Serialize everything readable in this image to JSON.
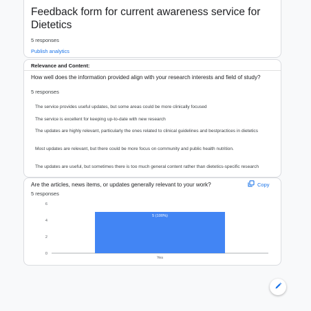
{
  "header": {
    "title": "Feedback form for current awareness service for Dietetics",
    "response_count": "5 responses",
    "publish_link": "Publish analytics"
  },
  "section": {
    "label": "Relevance and Content:"
  },
  "question1": {
    "title": "How well does the information provided align with your research interests and field of study?",
    "response_count": "5 responses",
    "answers": [
      "The service provides useful updates, but some areas could be more clinically focused",
      "The service is excellent for keeping up-to-date with new research",
      "The updates are highly relevant, particularly the ones related to clinical guidelines and bestpractices in dietetics",
      "Most updates are relevant, but there could be more focus on community and public health nutrition.",
      "The updates are useful, but sometimes there is too much general content rather than dietetics-specific research"
    ]
  },
  "question2": {
    "title": "Are the articles, news items, or updates generally relevant to your work?",
    "copy_label": "Copy",
    "response_count": "5 responses"
  },
  "chart_data": {
    "type": "bar",
    "categories": [
      "Yes"
    ],
    "values": [
      5
    ],
    "data_labels": [
      "5 (100%)"
    ],
    "ylim": [
      0,
      6
    ],
    "yticks": [
      0,
      2,
      4,
      6
    ],
    "bar_color": "#4285f4",
    "grid": false
  },
  "colors": {
    "accent": "#1a73e8",
    "bar": "#4285f4"
  },
  "icons": {
    "copy": "copy-icon",
    "edit": "pencil-icon"
  }
}
